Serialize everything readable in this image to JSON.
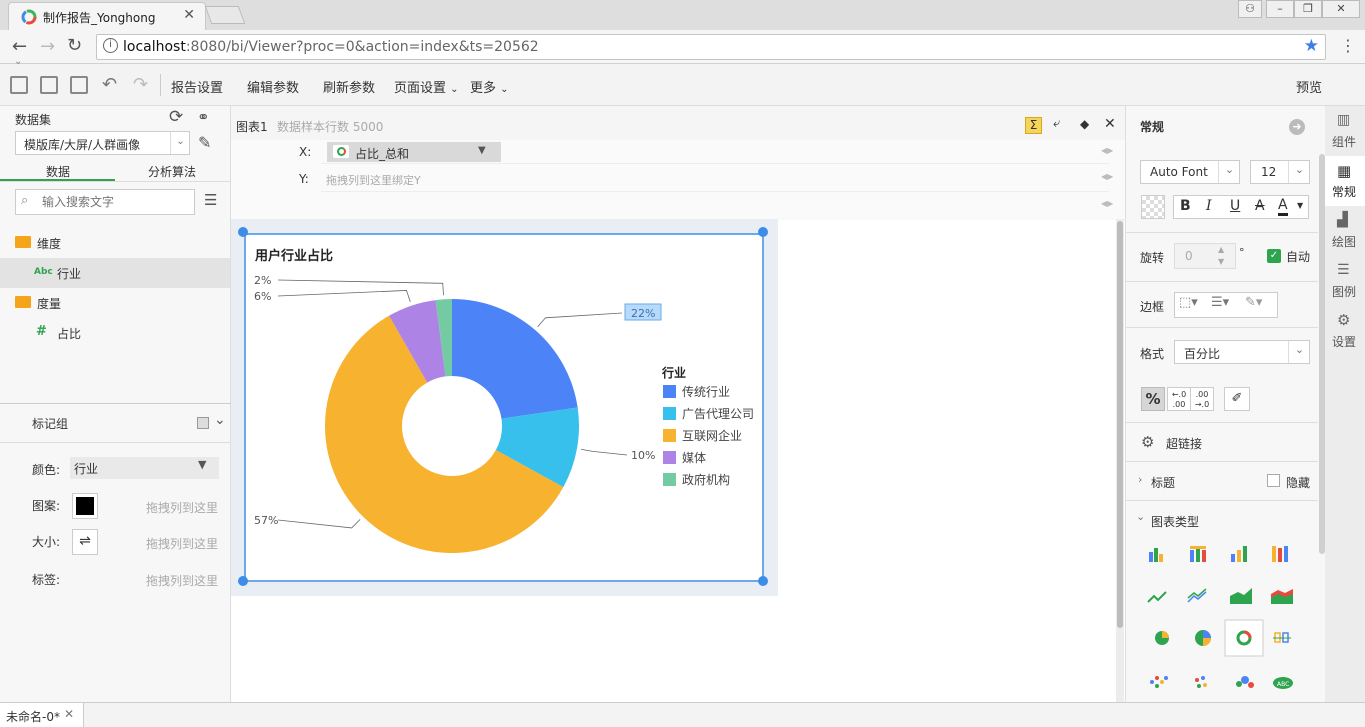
{
  "browser": {
    "tab_title": "制作报告_Yonghong",
    "url_host": "localhost",
    "url_rest": ":8080/bi/Viewer?proc=0&action=index&ts=20562"
  },
  "toolbar": {
    "report_settings": "报告设置",
    "edit_params": "编辑参数",
    "refresh_params": "刷新参数",
    "page_settings": "页面设置",
    "more": "更多",
    "preview": "预览"
  },
  "left": {
    "dataset_label": "数据集",
    "dataset_value": "模版库/大屏/人群画像",
    "tab_data": "数据",
    "tab_algo": "分析算法",
    "search_placeholder": "输入搜索文字",
    "dimension_folder": "维度",
    "dimension_item": "行业",
    "dimension_type": "Abc",
    "measure_folder": "度量",
    "measure_item": "占比",
    "marks_title": "标记组",
    "color_label": "颜色:",
    "color_value": "行业",
    "pattern_label": "图案:",
    "size_label": "大小:",
    "label_label": "标签:",
    "drop_hint": "拖拽列到这里"
  },
  "center": {
    "chart_name": "图表1",
    "sample_rows": "数据样本行数 5000",
    "x_label": "X:",
    "x_value": "占比_总和",
    "y_label": "Y:",
    "y_hint": "拖拽列到这里绑定Y"
  },
  "right": {
    "title": "常规",
    "font": "Auto Font",
    "font_size": "12",
    "rotate_label": "旋转",
    "rotate_value": "0",
    "degree": "°",
    "auto_label": "自动",
    "border_label": "边框",
    "format_label": "格式",
    "format_value": "百分比",
    "hyperlink": "超链接",
    "title_section": "标题",
    "hide_label": "隐藏",
    "chart_type_section": "图表类型"
  },
  "right_tabs": [
    {
      "label": "组件"
    },
    {
      "label": "常规"
    },
    {
      "label": "绘图"
    },
    {
      "label": "图例"
    },
    {
      "label": "设置"
    }
  ],
  "statusbar": {
    "tab": "未命名-0*"
  },
  "colors": {
    "accent": "#4a8af4",
    "green": "#2ea44f",
    "selection": "#3d8de8"
  },
  "chart_data": {
    "type": "pie",
    "title": "用户行业占比",
    "legend_title": "行业",
    "legend_position": "right",
    "donut": true,
    "categories": [
      "传统行业",
      "广告代理公司",
      "互联网企业",
      "媒体",
      "政府机构"
    ],
    "values": [
      22,
      10,
      57,
      6,
      2
    ],
    "labels": [
      "22%",
      "10%",
      "57%",
      "6%",
      "2%"
    ],
    "colors": [
      "#4c84f7",
      "#38c0ec",
      "#f7b22f",
      "#ad84e6",
      "#74cba3"
    ]
  }
}
